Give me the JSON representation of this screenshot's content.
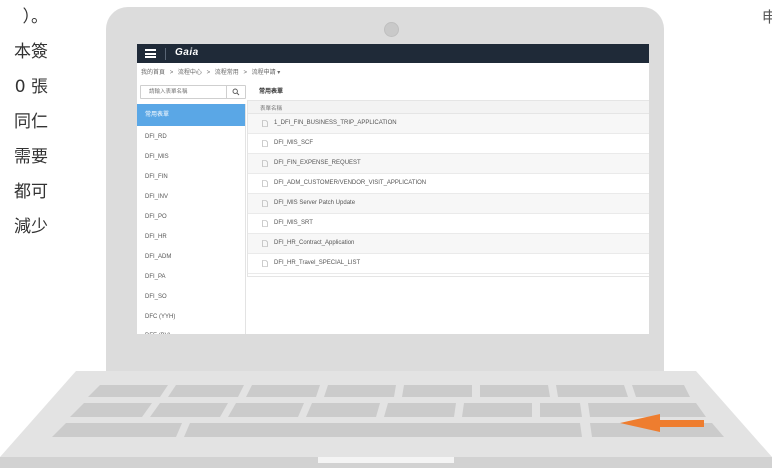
{
  "left_text": [
    "）。",
    "本簽",
    "0 張",
    "同仁",
    "需要",
    "都可",
    "減少"
  ],
  "right_char": "申",
  "app": {
    "logo": "Gaia",
    "breadcrumb": [
      "我的首頁",
      ">",
      "流程中心",
      ">",
      "流程常用",
      ">",
      "流程申請 ▾"
    ],
    "search_placeholder": "請輸入表單名稱",
    "sidebar": [
      "常用表單",
      "DFI_RD",
      "DFI_MIS",
      "DFI_FIN",
      "DFI_INV",
      "DFI_PO",
      "DFI_HR",
      "DFI_ADM",
      "DFI_PA",
      "DFI_SO",
      "DFC (YYH)",
      "DFE (BV)"
    ],
    "content_title": "常用表單",
    "list_header": "表單名稱",
    "forms": [
      "1_DFI_FIN_BUSINESS_TRIP_APPLICATION",
      "DFI_MIS_SCF",
      "DFI_FIN_EXPENSE_REQUEST",
      "DFI_ADM_CUSTOMER/VENDOR_VISIT_APPLICATION",
      "DFI_MIS Server Patch Update",
      "DFI_MIS_SRT",
      "DFI_HR_Contract_Application",
      "DFI_HR_Travel_SPECIAL_LIST"
    ]
  },
  "colors": {
    "topbar": "#1f2a38",
    "active": "#5aa7e6",
    "arrow": "#ee7d2f"
  }
}
